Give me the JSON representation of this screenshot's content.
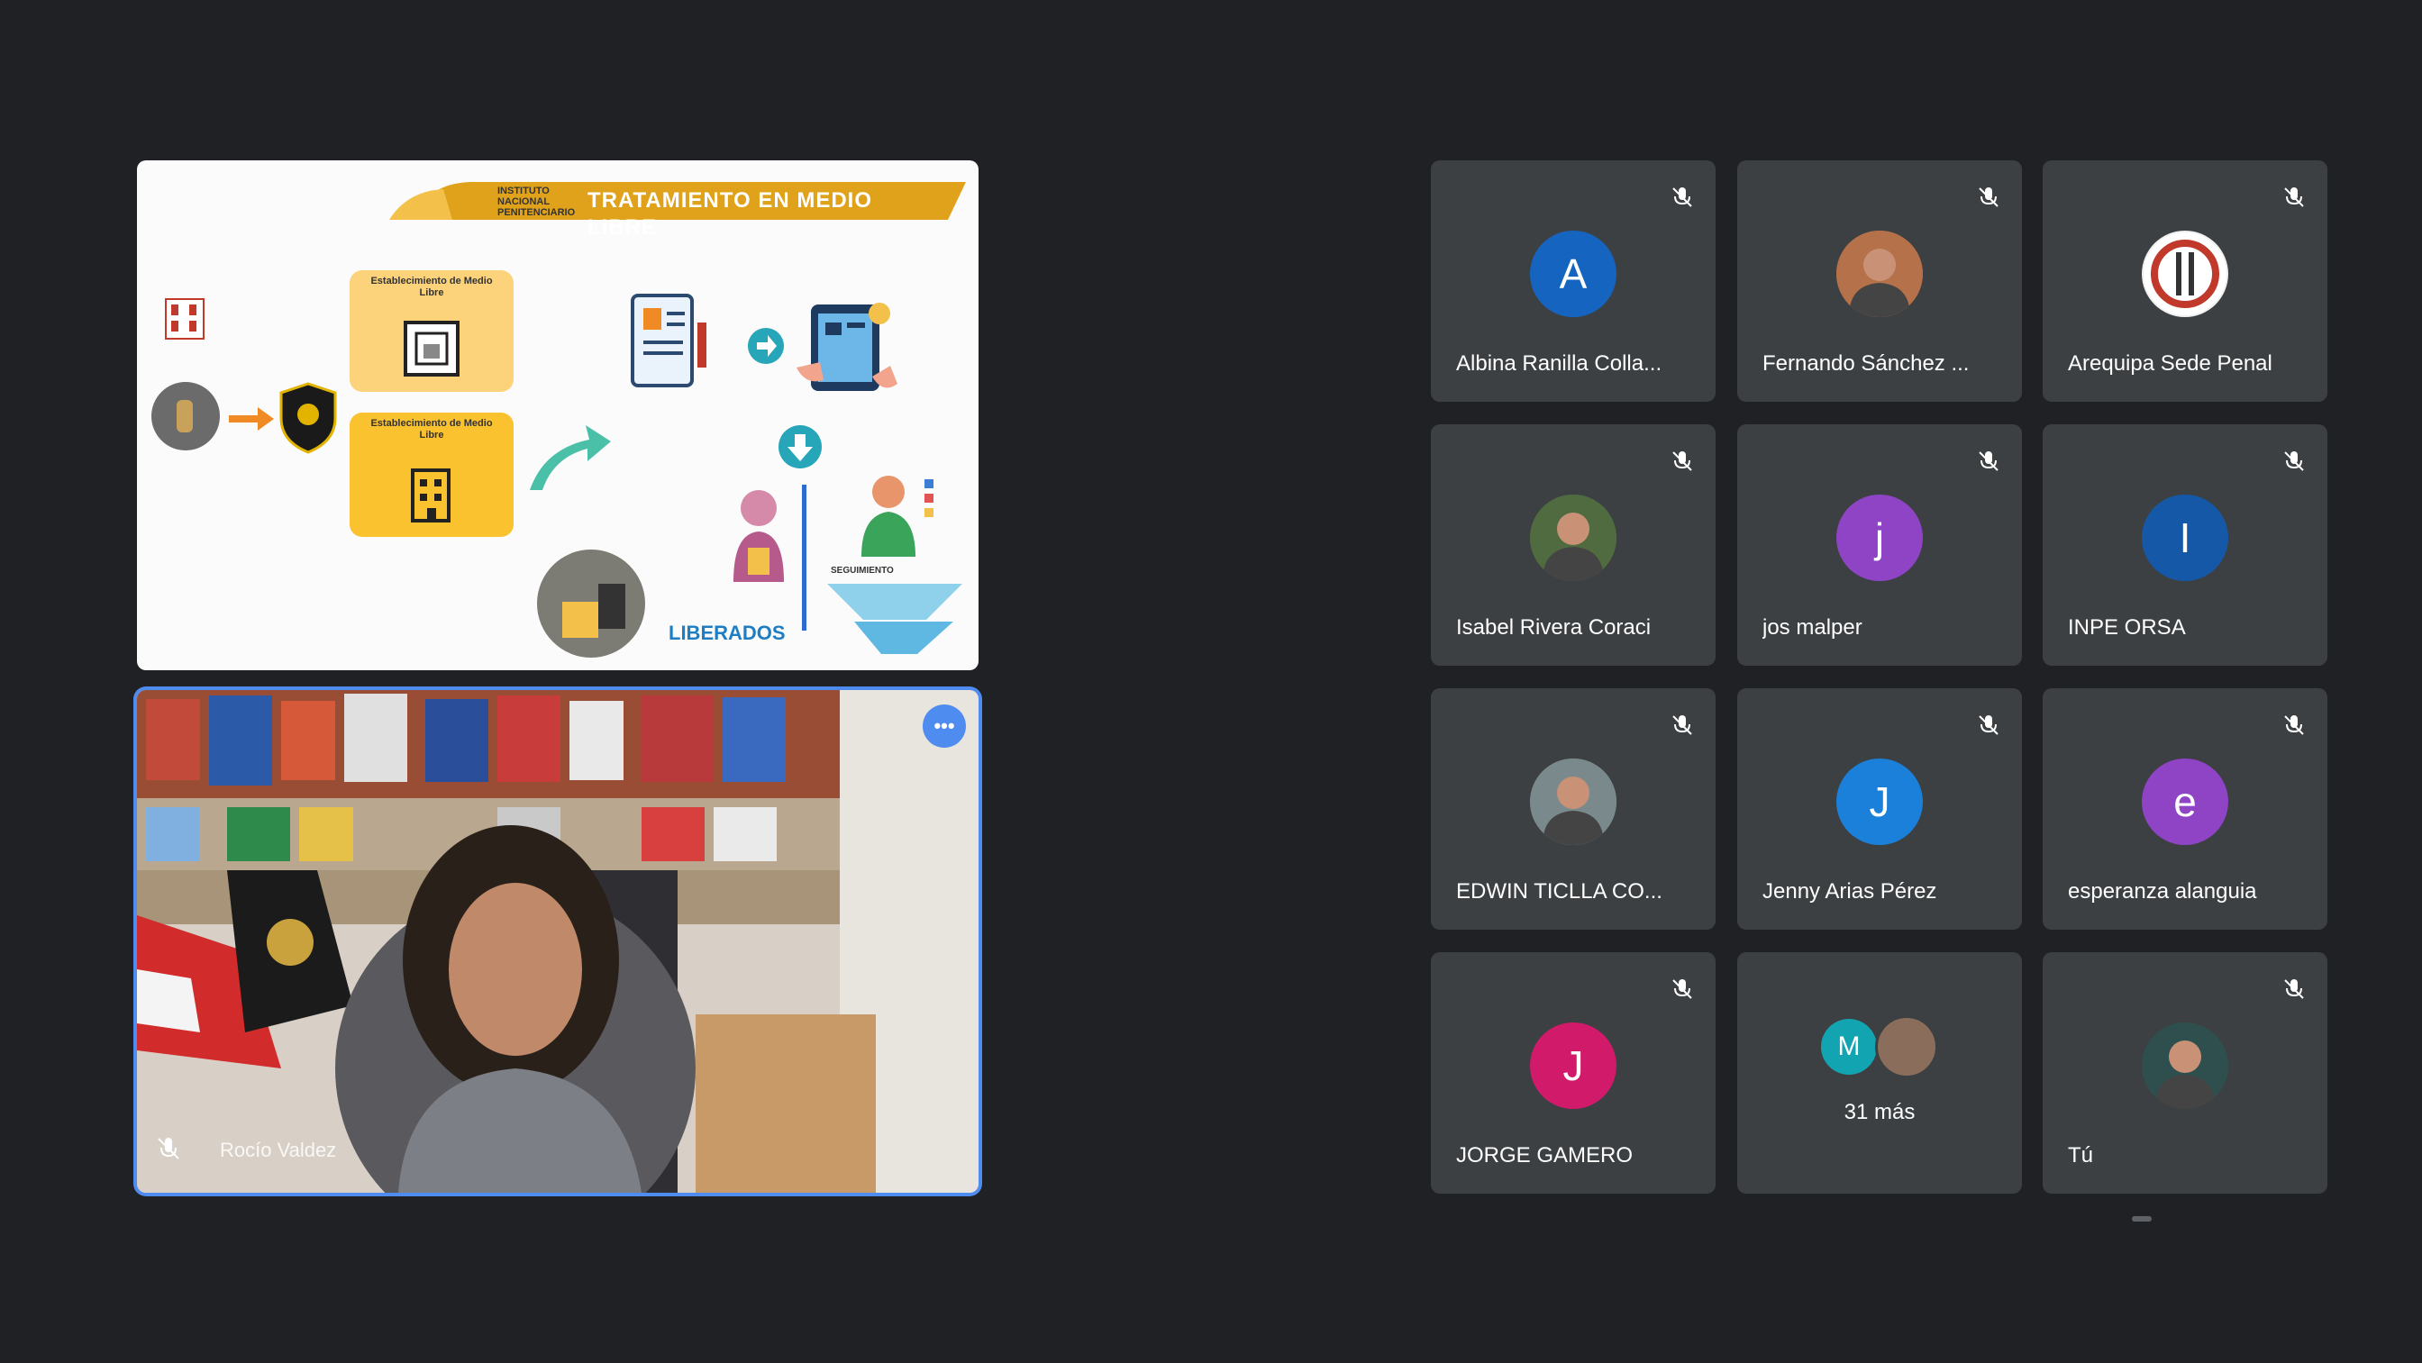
{
  "presentation": {
    "title": "TRATAMIENTO EN MEDIO LIBRE",
    "brand": "INSTITUTO NACIONAL PENITENCIARIO",
    "box1_label": "Establecimiento de Medio Libre",
    "box2_label": "Establecimiento de Medio Libre",
    "caption": "SEGUIMIENTO",
    "logo_text": "LIBERADOS"
  },
  "speaker": {
    "name": "Rocío Valdez",
    "menu_icon": "more-options-icon"
  },
  "participants": [
    {
      "name": "Albina Ranilla Colla...",
      "initial": "A",
      "color": "#1565c0",
      "type": "letter"
    },
    {
      "name": "Fernando Sánchez ...",
      "initial": "",
      "color": "#b5714a",
      "type": "photo"
    },
    {
      "name": "Arequipa Sede Penal",
      "initial": "",
      "color": "#f1f1f1",
      "type": "logo"
    },
    {
      "name": "Isabel Rivera Coraci",
      "initial": "",
      "color": "#4f6b3f",
      "type": "photo"
    },
    {
      "name": "jos malper",
      "initial": "j",
      "color": "#8e44c5",
      "type": "letter"
    },
    {
      "name": "INPE ORSA",
      "initial": "I",
      "color": "#1558a8",
      "type": "letter"
    },
    {
      "name": "EDWIN TICLLA CO...",
      "initial": "",
      "color": "#7a8a8c",
      "type": "photo"
    },
    {
      "name": "Jenny Arias Pérez",
      "initial": "J",
      "color": "#1a80d9",
      "type": "letter"
    },
    {
      "name": "esperanza alanguia",
      "initial": "e",
      "color": "#8e44c5",
      "type": "letter"
    },
    {
      "name": "JORGE GAMERO",
      "initial": "J",
      "color": "#d11a6a",
      "type": "letter"
    },
    {
      "name": "Tú",
      "initial": "",
      "color": "#2f4f4f",
      "type": "photo"
    }
  ],
  "more": {
    "label": "31 más",
    "initial": "M",
    "color": "#12a4b0"
  }
}
